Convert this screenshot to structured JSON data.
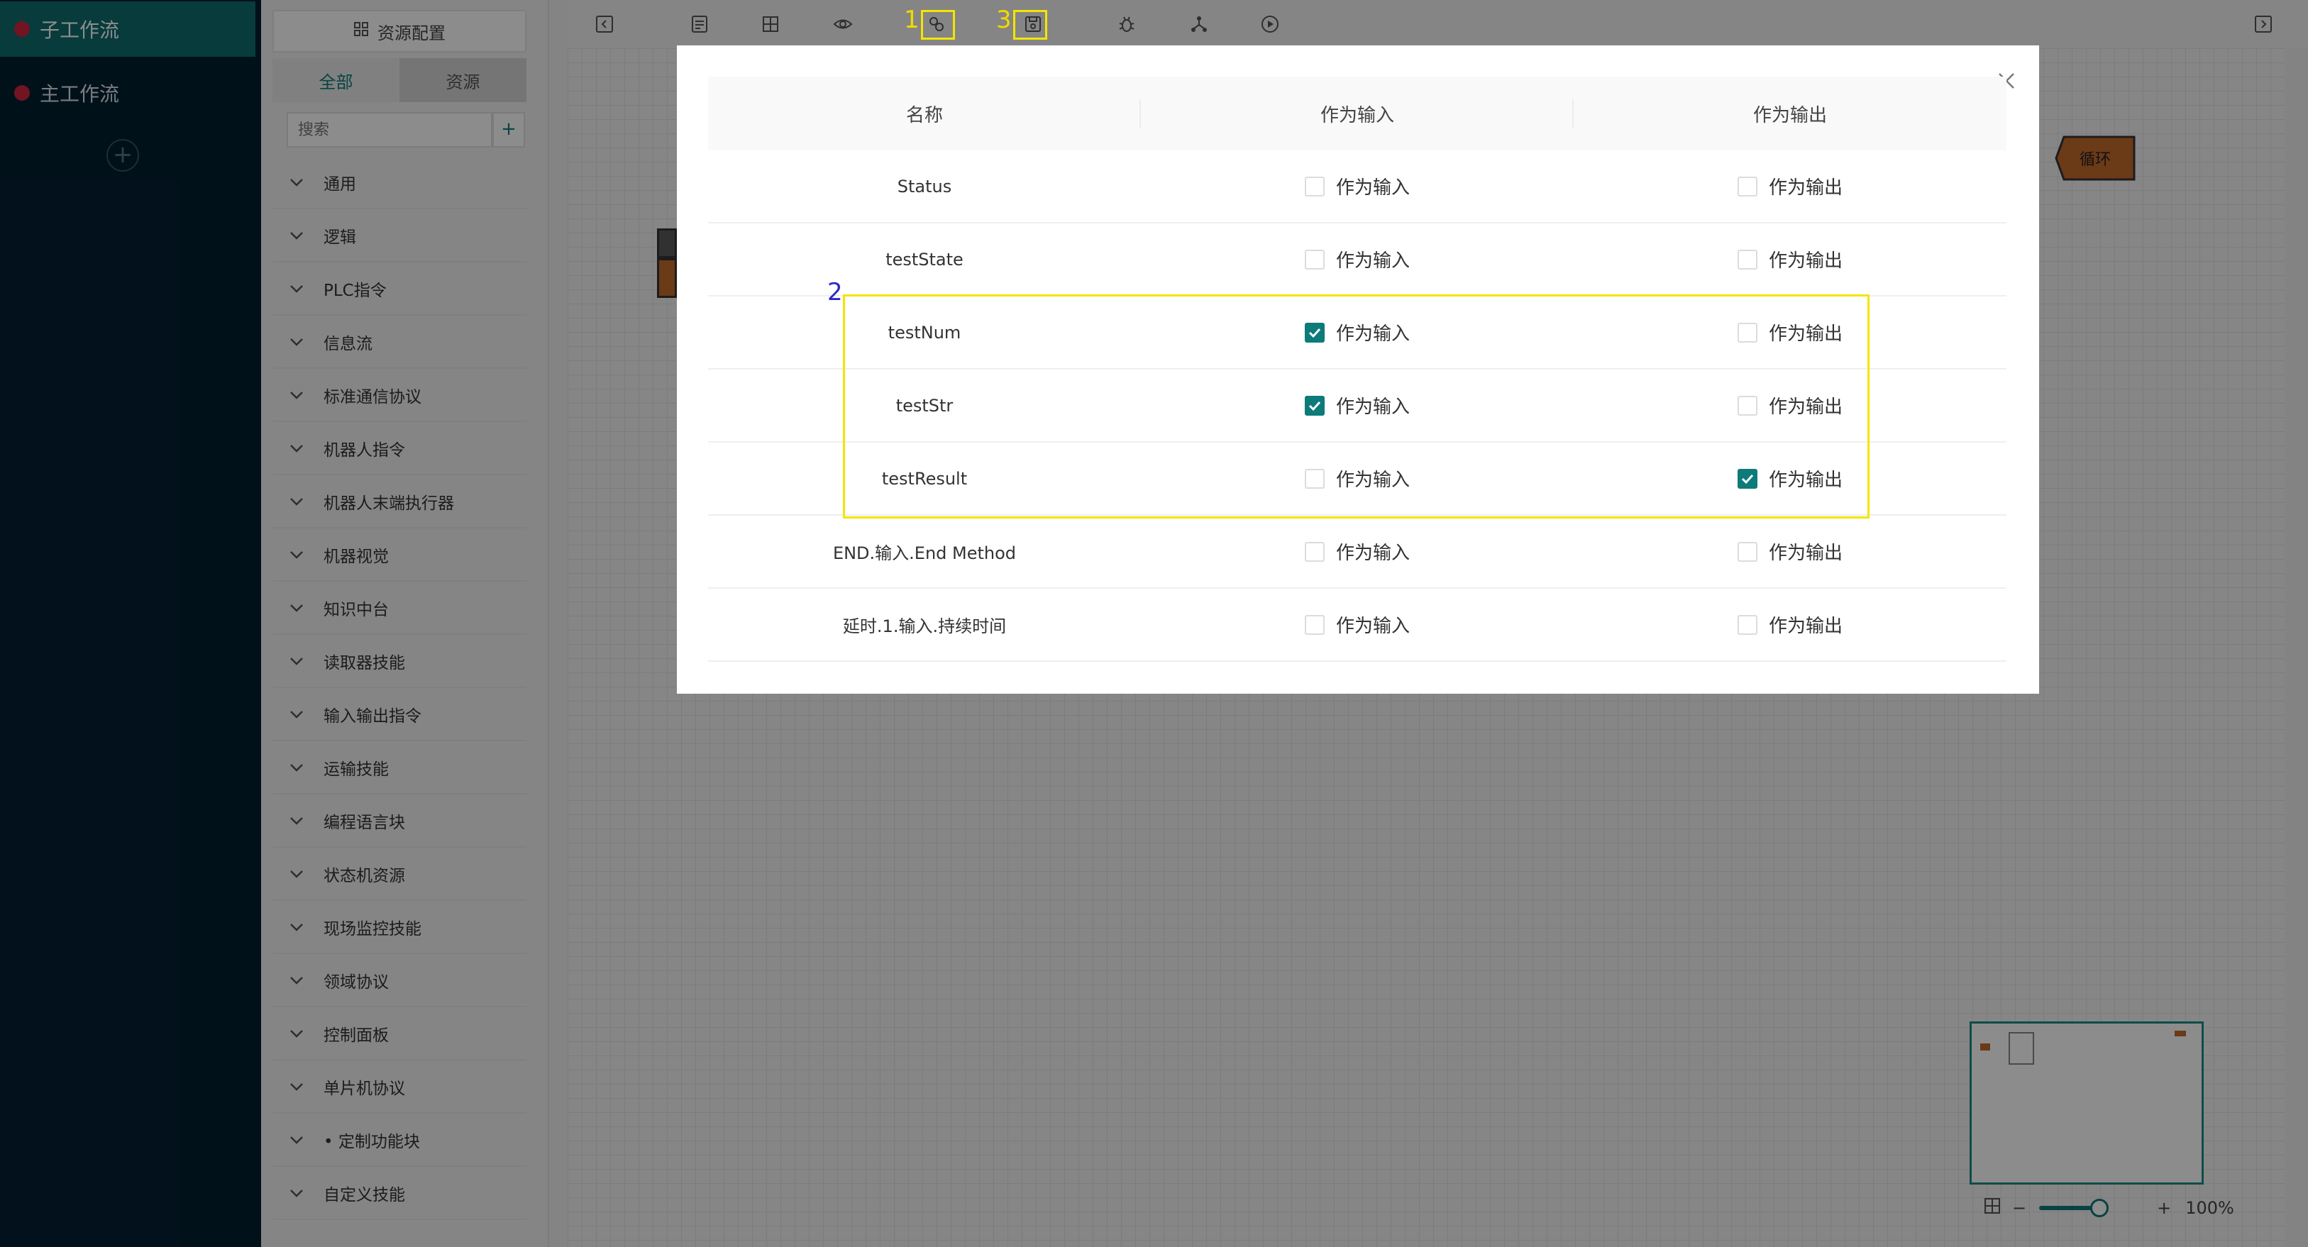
{
  "workflows": [
    {
      "label": "子工作流",
      "active": true
    },
    {
      "label": "主工作流",
      "active": false
    }
  ],
  "add_workflow": "+",
  "resource_panel": {
    "title": "资源配置",
    "tabs": [
      {
        "label": "全部",
        "active": true
      },
      {
        "label": "资源",
        "active": false
      }
    ],
    "search_placeholder": "搜索",
    "add_label": "+",
    "categories": [
      "通用",
      "逻辑",
      "PLC指令",
      "信息流",
      "标准通信协议",
      "机器人指令",
      "机器人末端执行器",
      "机器视觉",
      "知识中台",
      "读取器技能",
      "输入输出指令",
      "运输技能",
      "编程语言块",
      "状态机资源",
      "现场监控技能",
      "领域协议",
      "控制面板",
      "单片机协议",
      "• 定制功能块",
      "自定义技能"
    ]
  },
  "canvas": {
    "loop_node_label": "循环"
  },
  "annotations": {
    "n1": "1",
    "n2": "2",
    "n3": "3"
  },
  "zoom": {
    "minus": "−",
    "plus": "+",
    "value": "100%"
  },
  "modal": {
    "columns": [
      "名称",
      "作为输入",
      "作为输出"
    ],
    "input_label": "作为输入",
    "output_label": "作为输出",
    "rows": [
      {
        "name": "Status",
        "input": false,
        "output": false
      },
      {
        "name": "testState",
        "input": false,
        "output": false
      },
      {
        "name": "testNum",
        "input": true,
        "output": false
      },
      {
        "name": "testStr",
        "input": true,
        "output": false
      },
      {
        "name": "testResult",
        "input": false,
        "output": true
      },
      {
        "name": "END.输入.End Method",
        "input": false,
        "output": false
      },
      {
        "name": "延时.1.输入.持续时间",
        "input": false,
        "output": false
      }
    ]
  },
  "colors": {
    "accent": "#0d7b79",
    "sidebar_bg": "#031f31",
    "highlight": "#f3e500",
    "loop_node": "#c46a2a"
  }
}
